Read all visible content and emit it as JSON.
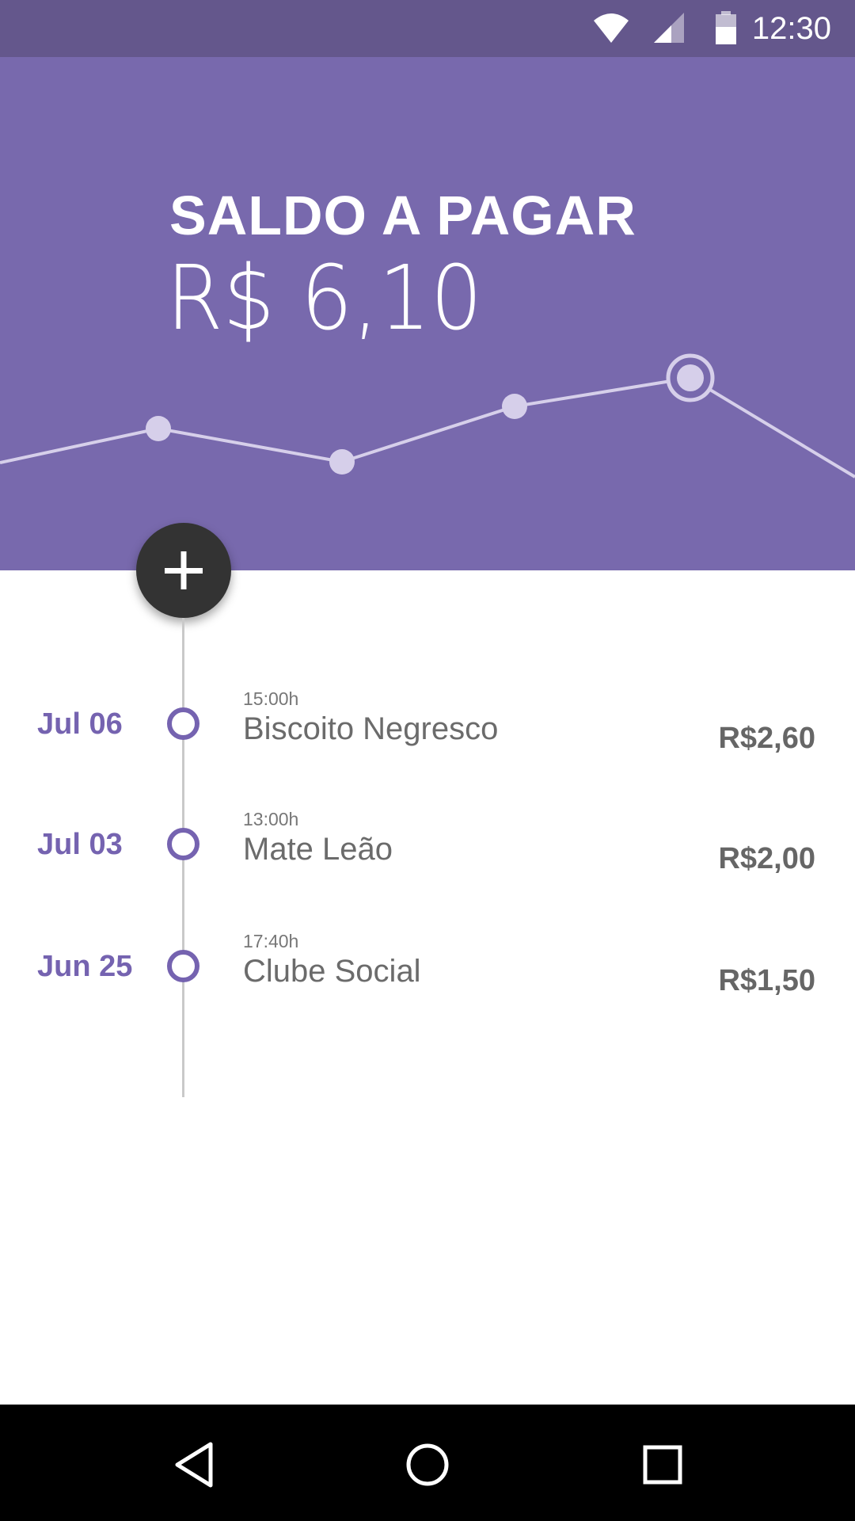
{
  "status_bar": {
    "time": "12:30",
    "icons": [
      "wifi-icon",
      "cell-signal-icon",
      "battery-icon"
    ]
  },
  "header": {
    "title": "SALDO A PAGAR",
    "amount": "R$ 6,10"
  },
  "trend_chart": {
    "type": "line",
    "points": 5,
    "highlighted_index": 4
  },
  "fab": {
    "icon": "plus-icon"
  },
  "transactions": [
    {
      "date": "Jul 06",
      "time": "15:00h",
      "name": "Biscoito Negresco",
      "price": "R$2,60"
    },
    {
      "date": "Jul 03",
      "time": "13:00h",
      "name": "Mate Leão",
      "price": "R$2,00"
    },
    {
      "date": "Jun 25",
      "time": "17:40h",
      "name": "Clube Social",
      "price": "R$1,50"
    }
  ],
  "nav_bar": {
    "icons": [
      "back-icon",
      "home-icon",
      "recents-icon"
    ]
  },
  "colors": {
    "status_bar": "#64578c",
    "header": "#7869ad",
    "accent": "#7563b0",
    "fab": "#333333",
    "nav_bar": "#000000"
  }
}
